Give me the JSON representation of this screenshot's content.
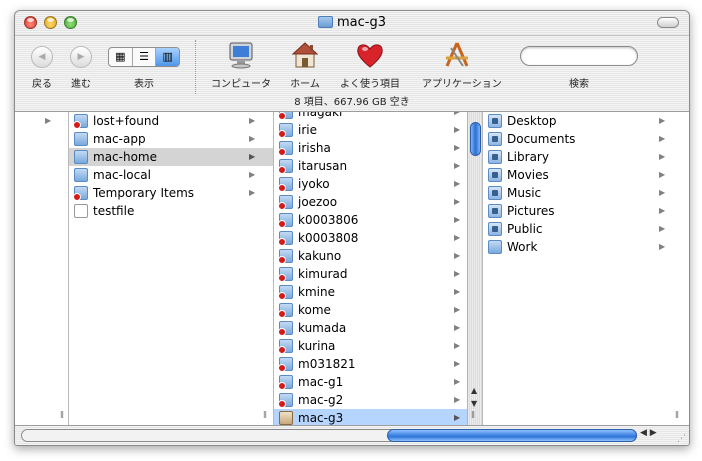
{
  "window": {
    "title": "mac-g3"
  },
  "toolbar": {
    "back_label": "戻る",
    "forward_label": "進む",
    "view_label": "表示",
    "computer_label": "コンピュータ",
    "home_label": "ホーム",
    "favorites_label": "よく使う項目",
    "applications_label": "アプリケーション",
    "search_label": "検索",
    "search_value": ""
  },
  "status": {
    "text": "8 項目、667.96 GB 空き"
  },
  "column1": {
    "items": [
      {
        "label": "",
        "has_arrow": true
      }
    ]
  },
  "column2": {
    "items": [
      {
        "label": "lost+found",
        "icon": "restricted-folder-icon"
      },
      {
        "label": "mac-app",
        "icon": "folder-icon"
      },
      {
        "label": "mac-home",
        "icon": "folder-icon",
        "selected": true
      },
      {
        "label": "mac-local",
        "icon": "folder-icon"
      },
      {
        "label": "Temporary Items",
        "icon": "restricted-folder-icon"
      },
      {
        "label": "testfile",
        "icon": "document-icon"
      }
    ]
  },
  "column3": {
    "items": [
      {
        "label": "magaki"
      },
      {
        "label": "irie"
      },
      {
        "label": "irisha"
      },
      {
        "label": "itarusan"
      },
      {
        "label": "iyoko"
      },
      {
        "label": "joezoo"
      },
      {
        "label": "k0003806"
      },
      {
        "label": "k0003808"
      },
      {
        "label": "kakuno"
      },
      {
        "label": "kimurad"
      },
      {
        "label": "kmine"
      },
      {
        "label": "kome"
      },
      {
        "label": "kumada"
      },
      {
        "label": "kurina"
      },
      {
        "label": "m031821"
      },
      {
        "label": "mac-g1"
      },
      {
        "label": "mac-g2"
      },
      {
        "label": "mac-g3",
        "selected": true
      }
    ]
  },
  "column4": {
    "items": [
      {
        "label": "Desktop"
      },
      {
        "label": "Documents"
      },
      {
        "label": "Library"
      },
      {
        "label": "Movies"
      },
      {
        "label": "Music"
      },
      {
        "label": "Pictures"
      },
      {
        "label": "Public"
      },
      {
        "label": "Work"
      }
    ]
  },
  "colors": {
    "selection_active": "#b5d5ff",
    "selection_inactive": "#d4d4d4",
    "restricted_badge": "#d21b1b"
  }
}
